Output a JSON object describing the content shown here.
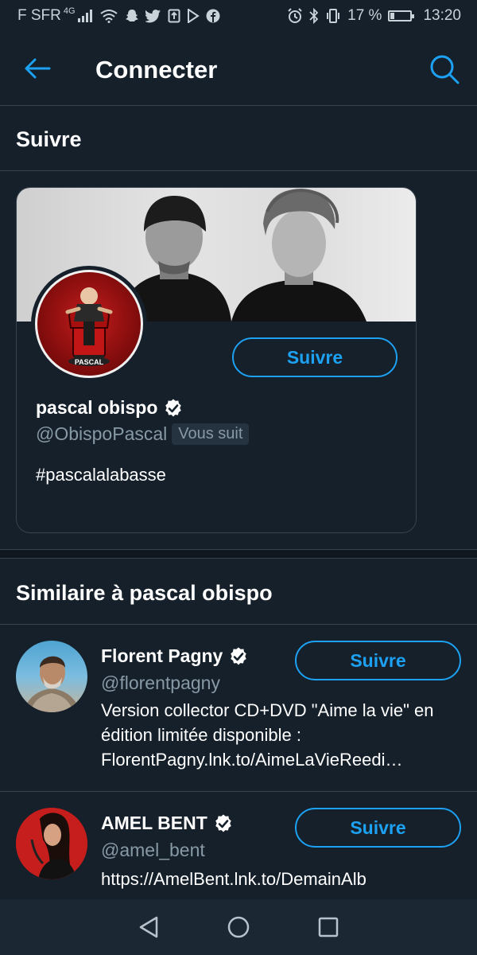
{
  "status_bar": {
    "carrier": "F SFR",
    "network": "4G",
    "battery_percent": "17 %",
    "battery_level": 0.17,
    "time": "13:20"
  },
  "header": {
    "title": "Connecter"
  },
  "suggested_section": {
    "title": "Suivre"
  },
  "featured_card": {
    "name": "pascal obispo",
    "handle": "@ObispoPascal",
    "follows_you": "Vous suit",
    "bio": "#pascalalabasse",
    "follow_label": "Suivre",
    "avatar_caption": "PASCAL",
    "verified": true
  },
  "similar_section": {
    "title": "Similaire à pascal obispo",
    "items": [
      {
        "name": "Florent Pagny",
        "handle": "@florentpagny",
        "bio": "Version collector CD+DVD \"Aime la vie\" en édition limitée disponible : FlorentPagny.lnk.to/AimeLaVieReedi…",
        "follow_label": "Suivre",
        "verified": true
      },
      {
        "name": "AMEL BENT",
        "handle": "@amel_bent",
        "bio": "https://AmelBent.lnk.to/DemainAlb",
        "follow_label": "Suivre",
        "verified": true
      }
    ]
  },
  "colors": {
    "background": "#15202b",
    "accent": "#1da1f2",
    "secondary_text": "#8899a6",
    "border": "#38444d"
  }
}
